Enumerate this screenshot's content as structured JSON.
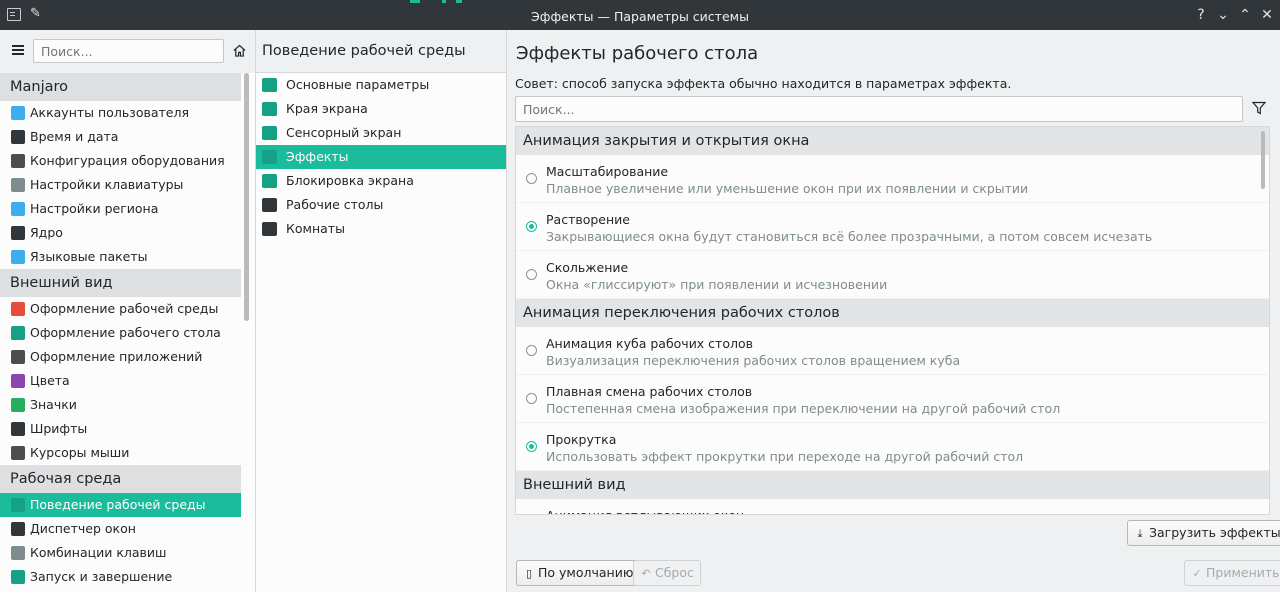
{
  "window": {
    "title": "Эффекты — Параметры системы",
    "controls": [
      "?",
      "⌄",
      "⌃",
      "✕"
    ]
  },
  "sidebar": {
    "search_placeholder": "Поиск...",
    "sections": [
      {
        "title": "Manjaro",
        "items": [
          {
            "label": "Аккаунты пользователя",
            "icon": "user-accounts-icon",
            "color": "#3daee9"
          },
          {
            "label": "Время и дата",
            "icon": "clock-icon",
            "color": "#31363b"
          },
          {
            "label": "Конфигурация оборудования",
            "icon": "hardware-icon",
            "color": "#4d4d4d"
          },
          {
            "label": "Настройки клавиатуры",
            "icon": "keyboard-icon",
            "color": "#7f8c8d"
          },
          {
            "label": "Настройки региона",
            "icon": "region-icon",
            "color": "#3daee9"
          },
          {
            "label": "Ядро",
            "icon": "kernel-icon",
            "color": "#31363b"
          },
          {
            "label": "Языковые пакеты",
            "icon": "language-icon",
            "color": "#3daee9"
          }
        ]
      },
      {
        "title": "Внешний вид",
        "items": [
          {
            "label": "Оформление рабочей среды",
            "icon": "workspace-theme-icon",
            "color": "#e74c3c"
          },
          {
            "label": "Оформление рабочего стола",
            "icon": "desktop-theme-icon",
            "color": "#16a085"
          },
          {
            "label": "Оформление приложений",
            "icon": "app-style-icon",
            "color": "#4d4d4d"
          },
          {
            "label": "Цвета",
            "icon": "colors-icon",
            "color": "#8e44ad"
          },
          {
            "label": "Значки",
            "icon": "icons-icon",
            "color": "#27ae60"
          },
          {
            "label": "Шрифты",
            "icon": "fonts-icon",
            "color": "#31363b"
          },
          {
            "label": "Курсоры мыши",
            "icon": "cursor-icon",
            "color": "#4d4d4d"
          }
        ]
      },
      {
        "title": "Рабочая среда",
        "items": [
          {
            "label": "Поведение рабочей среды",
            "icon": "workspace-behavior-icon",
            "color": "#16a085",
            "selected": true
          },
          {
            "label": "Диспетчер окон",
            "icon": "window-manager-icon",
            "color": "#31363b"
          },
          {
            "label": "Комбинации клавиш",
            "icon": "shortcuts-icon",
            "color": "#7f8c8d"
          },
          {
            "label": "Запуск и завершение",
            "icon": "startup-icon",
            "color": "#16a085"
          }
        ]
      }
    ]
  },
  "subcategory": {
    "title": "Поведение рабочей среды",
    "items": [
      {
        "label": "Основные параметры",
        "icon": "general-settings-icon",
        "color": "#16a085"
      },
      {
        "label": "Края экрана",
        "icon": "screen-edges-icon",
        "color": "#16a085"
      },
      {
        "label": "Сенсорный экран",
        "icon": "touchscreen-icon",
        "color": "#16a085"
      },
      {
        "label": "Эффекты",
        "icon": "effects-icon",
        "color": "#16a085",
        "selected": true
      },
      {
        "label": "Блокировка экрана",
        "icon": "screen-lock-icon",
        "color": "#16a085"
      },
      {
        "label": "Рабочие столы",
        "icon": "virtual-desktops-icon",
        "color": "#31363b"
      },
      {
        "label": "Комнаты",
        "icon": "activities-icon",
        "color": "#31363b"
      }
    ]
  },
  "main": {
    "title": "Эффекты рабочего стола",
    "hint": "Совет: способ запуска эффекта обычно находится в параметрах эффекта.",
    "search_placeholder": "Поиск...",
    "categories": [
      {
        "title": "Анимация закрытия и открытия окна",
        "effects": [
          {
            "name": "Масштабирование",
            "desc": "Плавное увеличение или уменьшение окон при их появлении и скрытии",
            "checked": false
          },
          {
            "name": "Растворение",
            "desc": "Закрывающиеся окна будут становиться всё более прозрачными, а потом совсем исчезать",
            "checked": true
          },
          {
            "name": "Скольжение",
            "desc": "Окна «глиссируют» при появлении и исчезновении",
            "checked": false
          }
        ]
      },
      {
        "title": "Анимация переключения рабочих столов",
        "effects": [
          {
            "name": "Анимация куба рабочих столов",
            "desc": "Визуализация переключения рабочих столов вращением куба",
            "checked": false
          },
          {
            "name": "Плавная смена рабочих столов",
            "desc": "Постепенная смена изображения при переключении на другой рабочий стол",
            "checked": false
          },
          {
            "name": "Прокрутка",
            "desc": "Использовать эффект прокрутки при переходе на другой рабочий стол",
            "checked": true
          }
        ]
      },
      {
        "title": "Внешний вид",
        "effects": [
          {
            "name": "Анимация всплывающих окон",
            "desc": "",
            "checked": false
          }
        ]
      }
    ],
    "load_button": "Загрузить эффекты...",
    "defaults_button": "По умолчанию",
    "reset_button": "Сброс",
    "apply_button": "Применить"
  },
  "colors": {
    "accent": "#1abc9c",
    "titlebar": "#31363b",
    "window_bg": "#eff0f1",
    "view_bg": "#fcfcfc"
  }
}
